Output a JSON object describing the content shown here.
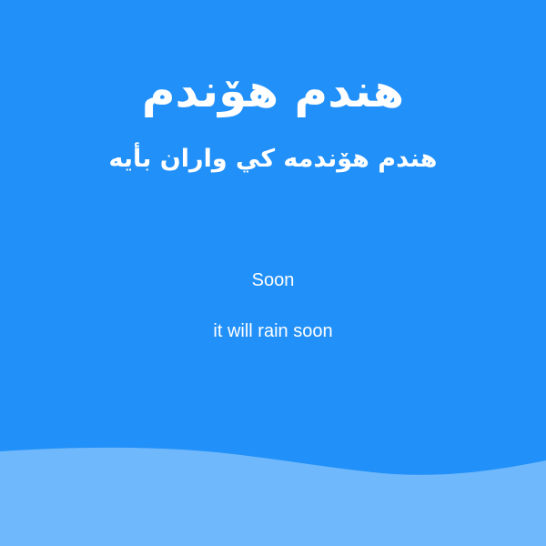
{
  "background_color": "#2190F9",
  "wave_color": "#6EB8FB",
  "text_color": "#FFFFFF",
  "heading": {
    "title_ar": "هندم هۆندم",
    "subtitle_ar": "هندم هۆندمه كي واران بأيه",
    "title_en": "Soon",
    "subtitle_en": "it will rain soon"
  }
}
